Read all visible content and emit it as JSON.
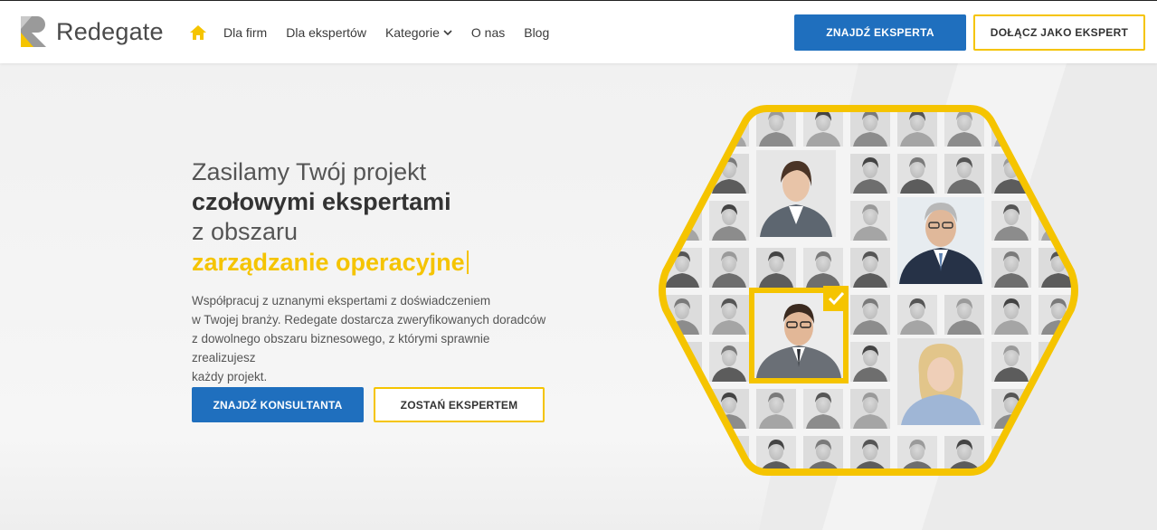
{
  "brand": {
    "name": "Redegate",
    "accent": "#f5c400",
    "primary": "#1f6fbe"
  },
  "nav": {
    "home_icon": "home-icon",
    "items": [
      {
        "label": "Dla firm"
      },
      {
        "label": "Dla ekspertów"
      },
      {
        "label": "Kategorie",
        "icon": "chevron-down-icon"
      },
      {
        "label": "O nas"
      },
      {
        "label": "Blog"
      }
    ]
  },
  "header_actions": {
    "find_expert": "ZNAJDŹ EKSPERTA",
    "join_expert": "DOŁĄCZ JAKO EKSPERT"
  },
  "hero": {
    "line1": "Zasilamy Twój projekt",
    "line2": "czołowymi ekspertami",
    "line3": "z obszaru",
    "line4": "zarządzanie operacyjne",
    "description": [
      "Współpracuj z uznanymi ekspertami z doświadczeniem",
      "w Twojej branży. Redegate dostarcza zweryfikowanych doradców",
      "z dowolnego obszaru biznesowego, z którymi sprawnie zrealizujesz",
      "każdy projekt."
    ],
    "cta_primary": "ZNAJDŹ KONSULTANTA",
    "cta_secondary": "ZOSTAŃ EKSPERTEM"
  },
  "expert_grid": {
    "highlight_icon": "check-icon"
  }
}
